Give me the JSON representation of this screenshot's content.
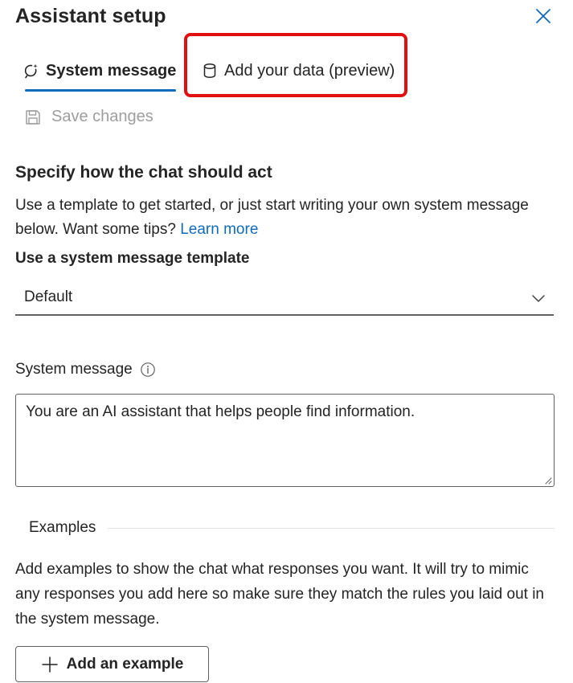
{
  "panel": {
    "title": "Assistant setup",
    "close_icon": "close-icon"
  },
  "tabs": [
    {
      "label": "System message",
      "icon": "system-message-icon",
      "selected": true
    },
    {
      "label": "Add your data (preview)",
      "icon": "database-icon",
      "selected": false
    }
  ],
  "toolbar": {
    "save_label": "Save changes",
    "save_icon": "save-icon",
    "save_disabled": true
  },
  "section": {
    "heading": "Specify how the chat should act",
    "description": "Use a template to get started, or just start writing your own system message below. Want some tips?",
    "learn_more": "Learn more"
  },
  "template": {
    "label": "Use a system message template",
    "selected_value": "Default"
  },
  "system_message": {
    "label": "System message",
    "value": "You are an AI assistant that helps people find information."
  },
  "examples": {
    "label": "Examples",
    "description": "Add examples to show the chat what responses you want. It will try to mimic any responses you add here so make sure they match the rules you laid out in the system message.",
    "add_button": "Add an example"
  },
  "colors": {
    "accent": "#0f6cbd",
    "highlight": "#e01010",
    "disabled_text": "#9e9e9e"
  }
}
